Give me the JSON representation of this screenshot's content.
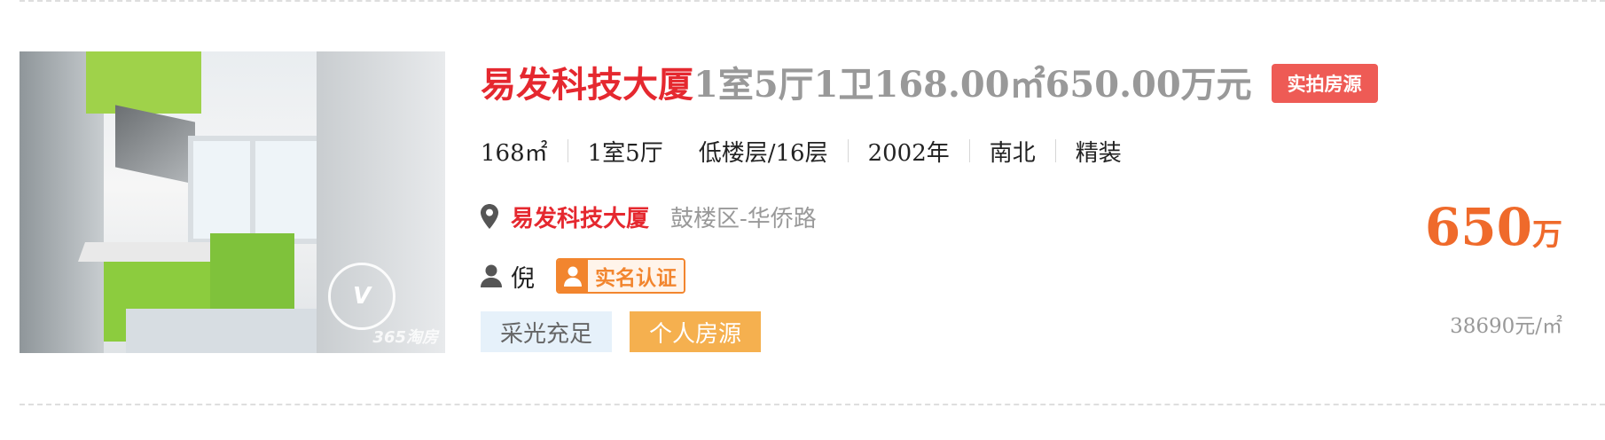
{
  "listing": {
    "title": {
      "name": "易发科技大厦",
      "spec": "1室5厅1卫168.00㎡650.00万元",
      "badge": "实拍房源"
    },
    "attributes": {
      "area": "168㎡",
      "layout": "1室5厅",
      "floor": "低楼层/16层",
      "year": "2002年",
      "orientation": "南北",
      "decoration": "精装"
    },
    "address": {
      "icon": "location-pin-icon",
      "community": "易发科技大厦",
      "district": "鼓楼区-华侨路"
    },
    "agent": {
      "icon": "person-icon",
      "name": "倪",
      "verified_label": "实名认证"
    },
    "tags": [
      "采光充足",
      "个人房源"
    ],
    "price": {
      "total": "650",
      "total_unit": "万",
      "unit_price": "38690元/㎡"
    },
    "thumbnail": {
      "panorama_badge": "V",
      "watermark": "365淘房"
    },
    "colors": {
      "title_red": "#e5282f",
      "price_orange": "#ef6a2b",
      "badge_red": "#ee5b55",
      "verify_orange": "#f2852e",
      "tag_light_bg": "#e6f1fa",
      "tag_orange_bg": "#f5b04f"
    }
  }
}
